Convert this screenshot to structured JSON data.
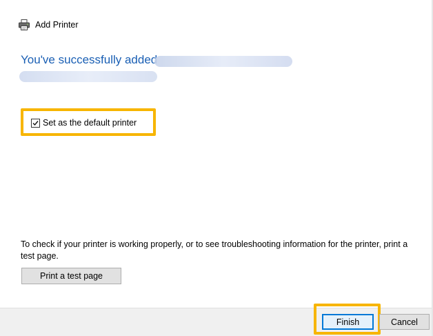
{
  "window": {
    "title": "Add Printer",
    "icon": "printer-icon"
  },
  "main": {
    "heading": "You've successfully added",
    "default_printer_label": "Set as the default printer",
    "default_printer_checked": true,
    "info_text": "To check if your printer is working properly, or to see troubleshooting information for the printer, print a test page.",
    "test_page_button": "Print a test page"
  },
  "footer": {
    "finish_label": "Finish",
    "cancel_label": "Cancel"
  },
  "colors": {
    "heading": "#1a5fb4",
    "highlight": "#f7b500",
    "default_button_border": "#0078d7"
  }
}
